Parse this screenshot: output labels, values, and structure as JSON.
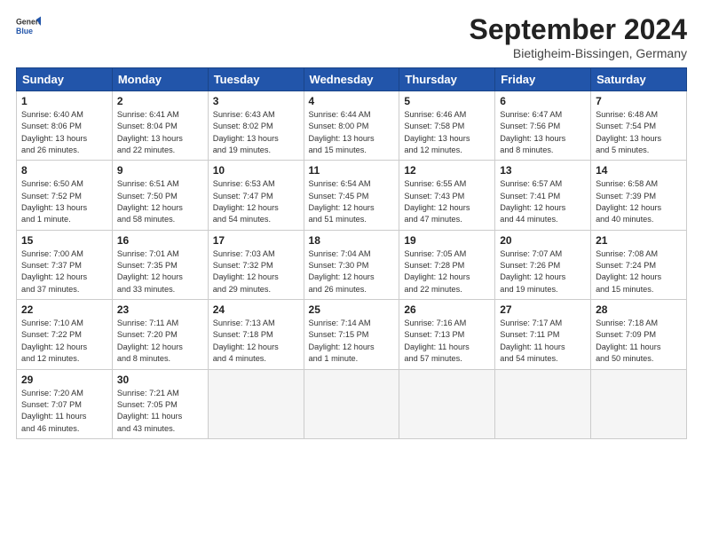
{
  "logo": {
    "general": "General",
    "blue": "Blue"
  },
  "header": {
    "month": "September 2024",
    "location": "Bietigheim-Bissingen, Germany"
  },
  "weekdays": [
    "Sunday",
    "Monday",
    "Tuesday",
    "Wednesday",
    "Thursday",
    "Friday",
    "Saturday"
  ],
  "weeks": [
    [
      {
        "day": "1",
        "info": "Sunrise: 6:40 AM\nSunset: 8:06 PM\nDaylight: 13 hours\nand 26 minutes."
      },
      {
        "day": "2",
        "info": "Sunrise: 6:41 AM\nSunset: 8:04 PM\nDaylight: 13 hours\nand 22 minutes."
      },
      {
        "day": "3",
        "info": "Sunrise: 6:43 AM\nSunset: 8:02 PM\nDaylight: 13 hours\nand 19 minutes."
      },
      {
        "day": "4",
        "info": "Sunrise: 6:44 AM\nSunset: 8:00 PM\nDaylight: 13 hours\nand 15 minutes."
      },
      {
        "day": "5",
        "info": "Sunrise: 6:46 AM\nSunset: 7:58 PM\nDaylight: 13 hours\nand 12 minutes."
      },
      {
        "day": "6",
        "info": "Sunrise: 6:47 AM\nSunset: 7:56 PM\nDaylight: 13 hours\nand 8 minutes."
      },
      {
        "day": "7",
        "info": "Sunrise: 6:48 AM\nSunset: 7:54 PM\nDaylight: 13 hours\nand 5 minutes."
      }
    ],
    [
      {
        "day": "8",
        "info": "Sunrise: 6:50 AM\nSunset: 7:52 PM\nDaylight: 13 hours\nand 1 minute."
      },
      {
        "day": "9",
        "info": "Sunrise: 6:51 AM\nSunset: 7:50 PM\nDaylight: 12 hours\nand 58 minutes."
      },
      {
        "day": "10",
        "info": "Sunrise: 6:53 AM\nSunset: 7:47 PM\nDaylight: 12 hours\nand 54 minutes."
      },
      {
        "day": "11",
        "info": "Sunrise: 6:54 AM\nSunset: 7:45 PM\nDaylight: 12 hours\nand 51 minutes."
      },
      {
        "day": "12",
        "info": "Sunrise: 6:55 AM\nSunset: 7:43 PM\nDaylight: 12 hours\nand 47 minutes."
      },
      {
        "day": "13",
        "info": "Sunrise: 6:57 AM\nSunset: 7:41 PM\nDaylight: 12 hours\nand 44 minutes."
      },
      {
        "day": "14",
        "info": "Sunrise: 6:58 AM\nSunset: 7:39 PM\nDaylight: 12 hours\nand 40 minutes."
      }
    ],
    [
      {
        "day": "15",
        "info": "Sunrise: 7:00 AM\nSunset: 7:37 PM\nDaylight: 12 hours\nand 37 minutes."
      },
      {
        "day": "16",
        "info": "Sunrise: 7:01 AM\nSunset: 7:35 PM\nDaylight: 12 hours\nand 33 minutes."
      },
      {
        "day": "17",
        "info": "Sunrise: 7:03 AM\nSunset: 7:32 PM\nDaylight: 12 hours\nand 29 minutes."
      },
      {
        "day": "18",
        "info": "Sunrise: 7:04 AM\nSunset: 7:30 PM\nDaylight: 12 hours\nand 26 minutes."
      },
      {
        "day": "19",
        "info": "Sunrise: 7:05 AM\nSunset: 7:28 PM\nDaylight: 12 hours\nand 22 minutes."
      },
      {
        "day": "20",
        "info": "Sunrise: 7:07 AM\nSunset: 7:26 PM\nDaylight: 12 hours\nand 19 minutes."
      },
      {
        "day": "21",
        "info": "Sunrise: 7:08 AM\nSunset: 7:24 PM\nDaylight: 12 hours\nand 15 minutes."
      }
    ],
    [
      {
        "day": "22",
        "info": "Sunrise: 7:10 AM\nSunset: 7:22 PM\nDaylight: 12 hours\nand 12 minutes."
      },
      {
        "day": "23",
        "info": "Sunrise: 7:11 AM\nSunset: 7:20 PM\nDaylight: 12 hours\nand 8 minutes."
      },
      {
        "day": "24",
        "info": "Sunrise: 7:13 AM\nSunset: 7:18 PM\nDaylight: 12 hours\nand 4 minutes."
      },
      {
        "day": "25",
        "info": "Sunrise: 7:14 AM\nSunset: 7:15 PM\nDaylight: 12 hours\nand 1 minute."
      },
      {
        "day": "26",
        "info": "Sunrise: 7:16 AM\nSunset: 7:13 PM\nDaylight: 11 hours\nand 57 minutes."
      },
      {
        "day": "27",
        "info": "Sunrise: 7:17 AM\nSunset: 7:11 PM\nDaylight: 11 hours\nand 54 minutes."
      },
      {
        "day": "28",
        "info": "Sunrise: 7:18 AM\nSunset: 7:09 PM\nDaylight: 11 hours\nand 50 minutes."
      }
    ],
    [
      {
        "day": "29",
        "info": "Sunrise: 7:20 AM\nSunset: 7:07 PM\nDaylight: 11 hours\nand 46 minutes."
      },
      {
        "day": "30",
        "info": "Sunrise: 7:21 AM\nSunset: 7:05 PM\nDaylight: 11 hours\nand 43 minutes."
      },
      {
        "day": "",
        "info": ""
      },
      {
        "day": "",
        "info": ""
      },
      {
        "day": "",
        "info": ""
      },
      {
        "day": "",
        "info": ""
      },
      {
        "day": "",
        "info": ""
      }
    ]
  ]
}
